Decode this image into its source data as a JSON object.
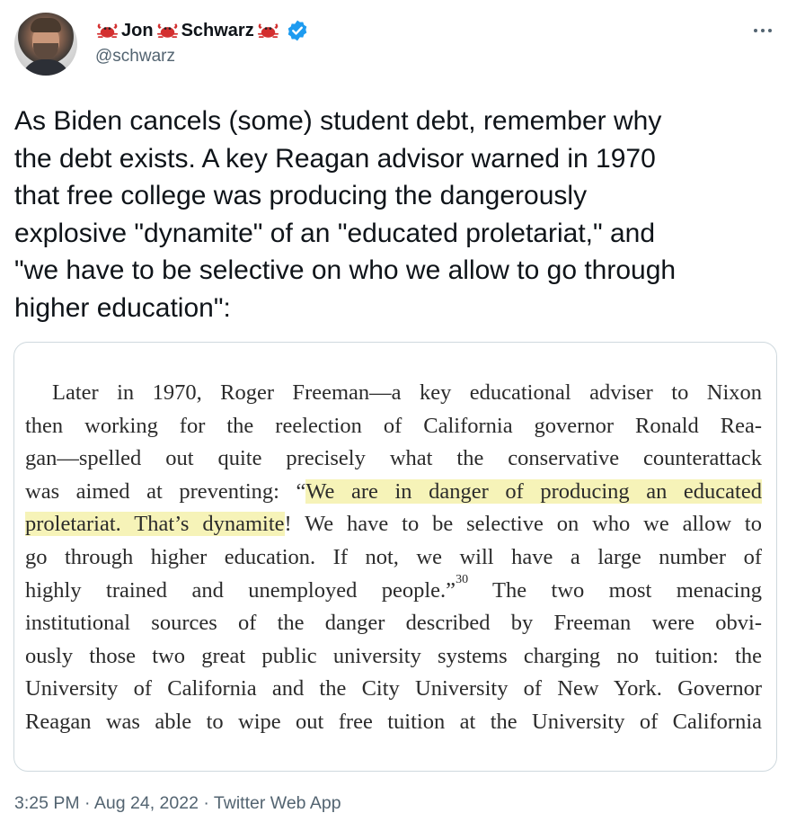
{
  "author": {
    "name_part1": "Jon",
    "name_part2": "Schwarz",
    "handle": "@schwarz",
    "verified": true,
    "name_emoji": "crab-icon"
  },
  "tweet": {
    "lines": [
      "As Biden cancels (some) student debt, remember why",
      "the debt exists. A key Reagan advisor warned in 1970",
      "that free college was producing the dangerously",
      "explosive \"dynamite\" of an \"educated proletariat,\" and",
      "\"we have to be selective on who we allow to go through",
      "higher education\":"
    ]
  },
  "book_excerpt": {
    "line1": "Later in 1970, Roger Freeman—a key educational adviser to Nixon",
    "line2": "then working for the reelection of California governor Ronald Rea-",
    "line3": "gan—spelled out quite precisely what the conservative counterattack",
    "line4_pre": "was aimed at preventing: “",
    "line4_hl": "We are in danger of producing an educated",
    "line5_hl": "proletariat. That’s dynamite",
    "line5_post": "! We have to be selective on who we allow to",
    "line6": "go through higher education. If not, we will have a large number of",
    "line7_pre": "highly trained and unemployed people.”",
    "line7_sup": "30",
    "line7_post": " The two most menacing",
    "line8": "institutional sources of the danger described by Freeman were obvi-",
    "line9": "ously those two great public university systems charging no tuition: the",
    "line10": "University of California and the City University of New York. Governor",
    "line11": "Reagan was able to wipe out free tuition at the University of California"
  },
  "meta": {
    "time": "3:25 PM",
    "date": "Aug 24, 2022",
    "source": "Twitter Web App",
    "separator": "·"
  },
  "colors": {
    "text": "#0f1419",
    "secondary": "#536471",
    "verified": "#1d9bf0",
    "highlight": "#f6f3b8",
    "border": "#cfd9de"
  }
}
